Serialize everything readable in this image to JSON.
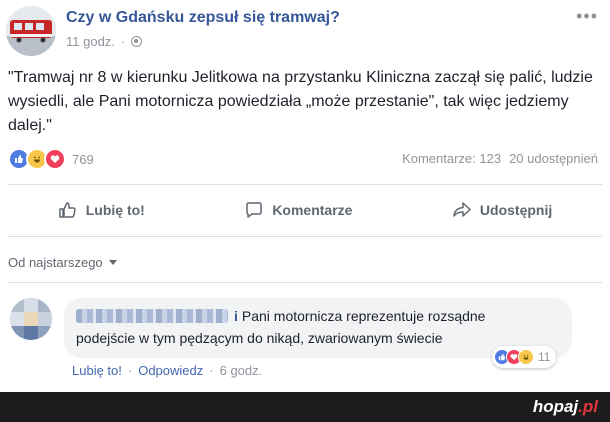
{
  "post": {
    "page_name": "Czy w Gdańsku zepsuł się tramwaj?",
    "time": "11 godz.",
    "more": "•••",
    "text": "\"Tramwaj nr 8 w kierunku Jelitkowa na przystanku Kliniczna zaczął się palić, ludzie wysiedli, ale Pani motornicza powiedziała „może przestanie\", tak więc jedziemy dalej.\"",
    "reactions_count": "769",
    "comments_count": "Komentarze: 123",
    "shares_count": "20 udostępnień"
  },
  "actions": {
    "like": "Lubię to!",
    "comment": "Komentarze",
    "share": "Udostępnij"
  },
  "sort": {
    "label": "Od najstarszego"
  },
  "comment": {
    "author_visible_tail": "i",
    "line1": "Pani motornicza reprezentuje rozsądne",
    "line2": "podejście w tym pędzącym do nikąd, zwariowanym świecie",
    "reactions_count": "11",
    "like": "Lubię to!",
    "reply": "Odpowiedz",
    "time": "6 godz.",
    "sep": "·"
  },
  "watermark": {
    "name": "hopaj",
    "suffix": ".pl"
  },
  "colors": {
    "link_blue": "#365899",
    "meta_gray": "#90949c",
    "like_blue": "#4f7ce0",
    "love_red": "#f0405b",
    "haha_yellow": "#f7c64a",
    "brand_red": "#e4393c"
  }
}
